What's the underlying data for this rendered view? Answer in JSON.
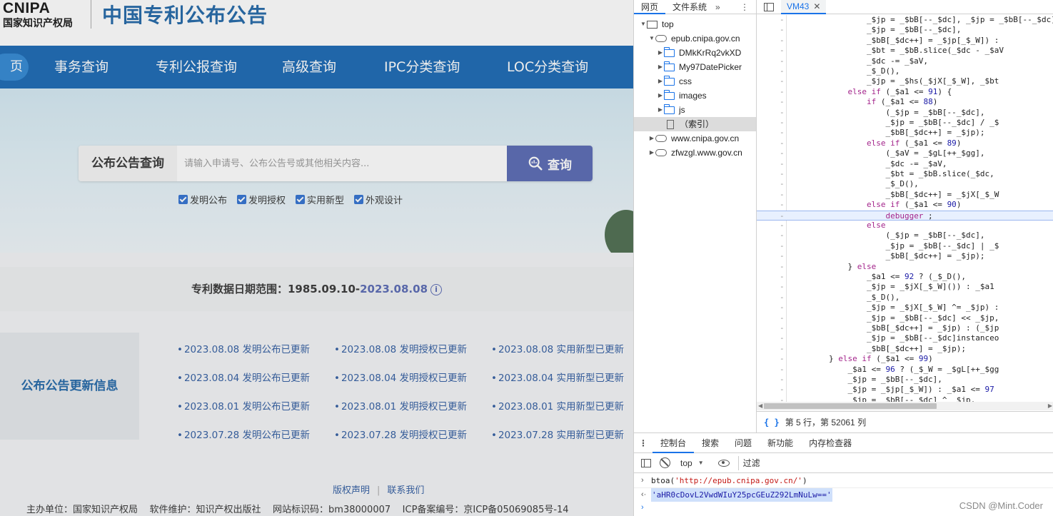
{
  "site": {
    "logo_text": "CNIPA",
    "logo_org": "国家知识产权局",
    "title": "中国专利公布公告",
    "nav": {
      "home": "页",
      "items": [
        "事务查询",
        "专利公报查询",
        "高级查询",
        "IPC分类查询",
        "LOC分类查询"
      ]
    },
    "search": {
      "label": "公布公告查询",
      "placeholder": "请输入申请号、公布公告号或其他相关内容...",
      "button": "查询",
      "checkboxes": [
        "发明公布",
        "发明授权",
        "实用新型",
        "外观设计"
      ]
    },
    "date_range": {
      "label": "专利数据日期范围：",
      "start": "1985.09.10-",
      "end": "2023.08.08"
    },
    "updates": {
      "label": "公布公告更新信息",
      "rows": [
        [
          "2023.08.08 发明公布已更新",
          "2023.08.08 发明授权已更新",
          "2023.08.08 实用新型已更新"
        ],
        [
          "2023.08.04 发明公布已更新",
          "2023.08.04 发明授权已更新",
          "2023.08.04 实用新型已更新"
        ],
        [
          "2023.08.01 发明公布已更新",
          "2023.08.01 发明授权已更新",
          "2023.08.01 实用新型已更新"
        ],
        [
          "2023.07.28 发明公布已更新",
          "2023.07.28 发明授权已更新",
          "2023.07.28 实用新型已更新"
        ]
      ]
    },
    "footer": {
      "links": [
        "版权声明",
        "联系我们"
      ],
      "info": "主办单位：国家知识产权局    软件维护：知识产权出版社    网站标识码：bm38000007    ICP备案编号：京ICP备05069085号-14"
    }
  },
  "devtools": {
    "nav_tabs": [
      "网页",
      "文件系统"
    ],
    "tree": [
      {
        "label": "top",
        "kind": "frame",
        "depth": 0,
        "open": true
      },
      {
        "label": "epub.cnipa.gov.cn",
        "kind": "cloud",
        "depth": 1,
        "open": true
      },
      {
        "label": "DMkKrRq2vkXD",
        "kind": "folder",
        "depth": 2,
        "open": false
      },
      {
        "label": "My97DatePicker",
        "kind": "folder",
        "depth": 2,
        "open": false
      },
      {
        "label": "css",
        "kind": "folder",
        "depth": 2,
        "open": false
      },
      {
        "label": "images",
        "kind": "folder",
        "depth": 2,
        "open": false
      },
      {
        "label": "js",
        "kind": "folder",
        "depth": 2,
        "open": false
      },
      {
        "label": "（索引）",
        "kind": "file",
        "depth": 2,
        "open": null,
        "selected": true
      },
      {
        "label": "www.cnipa.gov.cn",
        "kind": "cloud",
        "depth": 1,
        "open": false
      },
      {
        "label": "zfwzgl.www.gov.cn",
        "kind": "cloud",
        "depth": 1,
        "open": false
      }
    ],
    "editor_tab": "VM43",
    "code_lines": [
      "                _$jp = _$bB[--_$dc], _$jp = _$bB[--_$dc] / _$jp,",
      "                _$jp = _$bB[--_$dc],",
      "                _$bB[_$dc++] = _$jp[_$_W]) :",
      "                _$bt = _$bB.slice(_$dc - _$aV",
      "                _$dc -= _$aV,",
      "                _$_D(),",
      "                _$jp = _$hs(_$jX[_$_W], _$bt",
      "            else if (_$a1 <= 91) {",
      "                if (_$a1 <= 88)",
      "                    (_$jp = _$bB[--_$dc],",
      "                    _$jp = _$bB[--_$dc] / _$",
      "                    _$bB[_$dc++] = _$jp);",
      "                else if (_$a1 <= 89)",
      "                    (_$aV = _$gL[++_$gg],",
      "                    _$dc -= _$aV,",
      "                    _$bt = _$bB.slice(_$dc,",
      "                    _$_D(),",
      "                    _$bB[_$dc++] = _$jX[_$_W",
      "                else if (_$a1 <= 90)",
      "                    debugger ;",
      "                else",
      "                    (_$jp = _$bB[--_$dc],",
      "                    _$jp = _$bB[--_$dc] | _$",
      "                    _$bB[_$dc++] = _$jp);",
      "            } else",
      "                _$a1 <= 92 ? (_$_D(),",
      "                _$jp = _$jX[_$_W]()) : _$a1",
      "                _$_D(),",
      "                _$jp = _$jX[_$_W] ^= _$jp) :",
      "                _$jp = _$bB[--_$dc] << _$jp,",
      "                _$bB[_$dc++] = _$jp) : (_$jp",
      "                _$jp = _$bB[--_$dc]instanceo",
      "                _$bB[_$dc++] = _$jp);",
      "        } else if (_$a1 <= 99)",
      "            _$a1 <= 96 ? (_$_W = _$gL[++_$gg",
      "            _$jp = _$bB[--_$dc],",
      "            _$jp = _$jp[_$_W]) : _$a1 <= 97",
      "            _$jp = _$bB[--_$dc] ^ _$jp,"
    ],
    "highlight_line": 19,
    "status": "第 5 行，第 52061 列",
    "drawer_tabs": [
      "控制台",
      "搜索",
      "问题",
      "新功能",
      "内存检查器"
    ],
    "console_context": "top",
    "filter_placeholder": "过滤",
    "console_input": "btoa('http://epub.cnipa.gov.cn/')",
    "console_result": "'aHR0cDovL2VwdWIuY25pcGEuZ292LmNuLw=='"
  },
  "watermark": "CSDN @Mint.Coder"
}
